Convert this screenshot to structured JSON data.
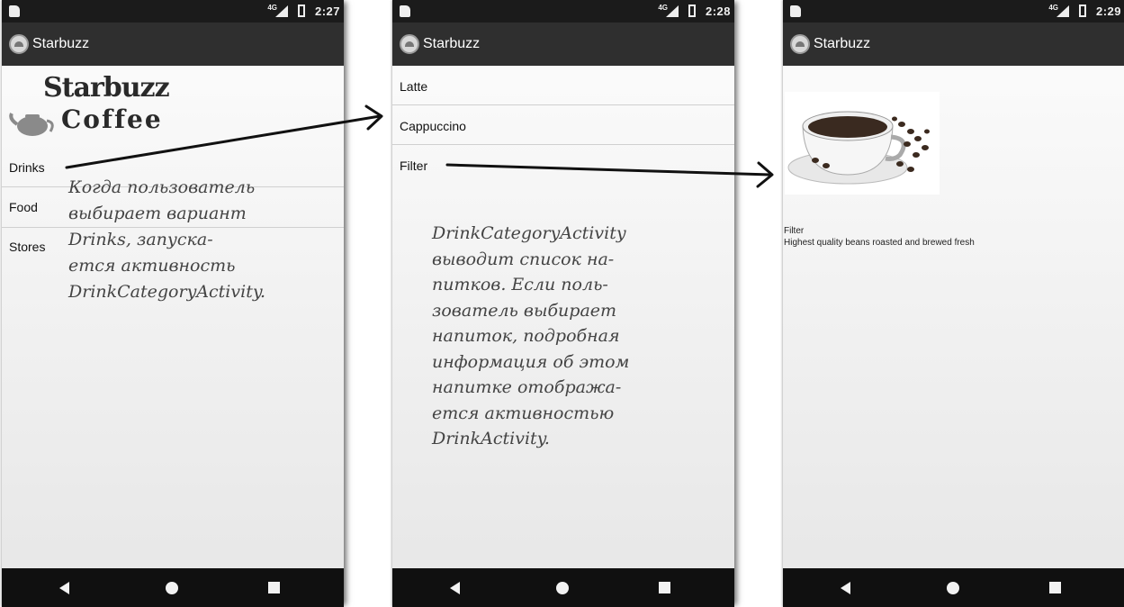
{
  "screens": [
    {
      "status_time": "2:27",
      "app_title": "Starbuzz",
      "logo": {
        "line1": "Starbuzz",
        "line2": "Coffee"
      },
      "items": [
        "Drinks",
        "Food",
        "Stores"
      ]
    },
    {
      "status_time": "2:28",
      "app_title": "Starbuzz",
      "items": [
        "Latte",
        "Cappuccino",
        "Filter"
      ]
    },
    {
      "status_time": "2:29",
      "app_title": "Starbuzz",
      "drink_name": "Filter",
      "drink_description": "Highest quality beans roasted and brewed fresh"
    }
  ],
  "annotations": {
    "first": [
      "Когда пользователь",
      "выбирает вариант",
      "Drinks, запуска-",
      "ется активность",
      "DrinkCategoryActivity."
    ],
    "second": [
      "DrinkCategoryActivity",
      "выводит список на-",
      "питков. Если поль-",
      "зователь выбирает",
      "напиток, подробная",
      "информация об этом",
      "напитке отобража-",
      "ется активностью",
      "DrinkActivity."
    ]
  },
  "icons": [
    "sim-icon",
    "network-icon",
    "battery-icon",
    "app-icon",
    "back-icon",
    "home-icon",
    "recent-apps-icon",
    "teapot-icon",
    "coffee-cup-image"
  ]
}
